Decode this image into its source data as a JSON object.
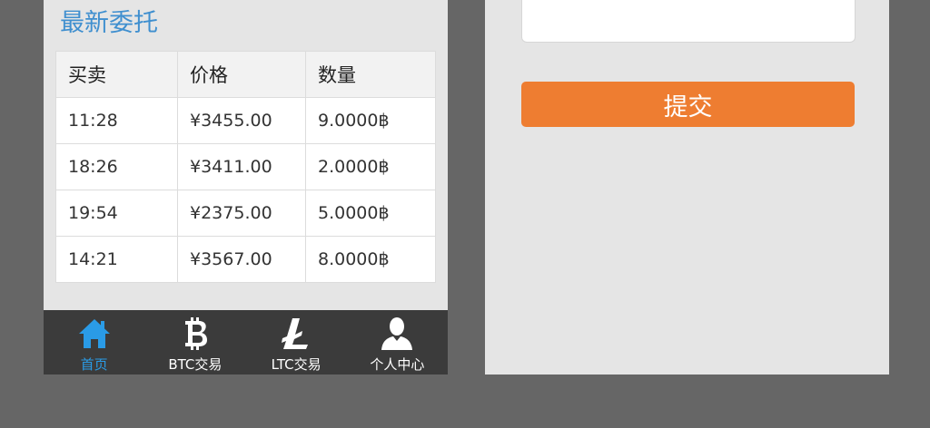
{
  "recent_orders": {
    "title": "最新委托",
    "headers": [
      "买卖",
      "价格",
      "数量"
    ],
    "rows": [
      {
        "time": "11:28",
        "price": "¥3455.00",
        "qty": "9.0000฿"
      },
      {
        "time": "18:26",
        "price": "¥3411.00",
        "qty": "2.0000฿"
      },
      {
        "time": "19:54",
        "price": "¥2375.00",
        "qty": "5.0000฿"
      },
      {
        "time": "14:21",
        "price": "¥3567.00",
        "qty": "8.0000฿"
      }
    ]
  },
  "tabbar": {
    "items": [
      {
        "label": "首页",
        "icon": "home-icon",
        "active": true
      },
      {
        "label": "BTC交易",
        "icon": "bitcoin-icon",
        "active": false
      },
      {
        "label": "LTC交易",
        "icon": "litecoin-icon",
        "active": false
      },
      {
        "label": "个人中心",
        "icon": "user-icon",
        "active": false
      }
    ]
  },
  "form": {
    "textarea_value": "",
    "submit_label": "提交"
  },
  "colors": {
    "background": "#666666",
    "panel": "#e5e5e5",
    "title_blue": "#3f8fcf",
    "tab_active": "#2a9be6",
    "tabbar_bg": "#3b3b3b",
    "submit_orange": "#ee7d31"
  }
}
